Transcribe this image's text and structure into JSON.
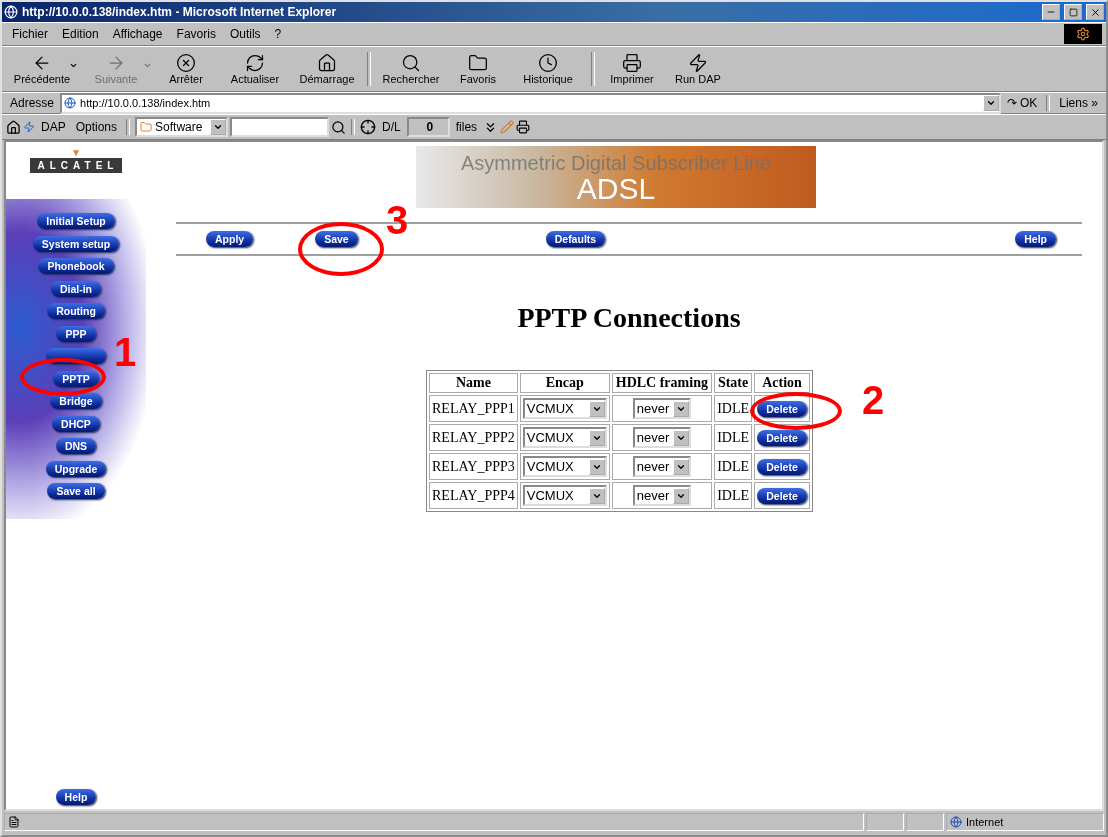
{
  "window": {
    "title": "http://10.0.0.138/index.htm - Microsoft Internet Explorer"
  },
  "menu": [
    "Fichier",
    "Edition",
    "Affichage",
    "Favoris",
    "Outils",
    "?"
  ],
  "toolbar": [
    {
      "label": "Précédente",
      "dropdown": true,
      "disabled": false
    },
    {
      "label": "Suivante",
      "dropdown": true,
      "disabled": true
    },
    {
      "label": "Arrêter",
      "dropdown": false,
      "disabled": false
    },
    {
      "label": "Actualiser",
      "dropdown": false,
      "disabled": false
    },
    {
      "label": "Démarrage",
      "dropdown": false,
      "disabled": false
    },
    {
      "label": "Rechercher",
      "dropdown": false,
      "disabled": false
    },
    {
      "label": "Favoris",
      "dropdown": false,
      "disabled": false
    },
    {
      "label": "Historique",
      "dropdown": false,
      "disabled": false
    },
    {
      "label": "Imprimer",
      "dropdown": false,
      "disabled": false
    },
    {
      "label": "Run DAP",
      "dropdown": false,
      "disabled": false
    }
  ],
  "address": {
    "label": "Adresse",
    "value": "http://10.0.0.138/index.htm",
    "go_glyph": "↷",
    "go": "OK",
    "links": "Liens",
    "links_glyph": "»"
  },
  "dap_bar": {
    "dap": "DAP",
    "options": "Options",
    "category": "Software",
    "dl_label": "D/L",
    "dl_count": "0",
    "files": "files"
  },
  "page": {
    "logo_mark": "▼",
    "logo": "ALCATEL",
    "banner_title": "ADSL",
    "banner_subtitle": "Asymmetric Digital Subscriber Line",
    "sidebar": [
      {
        "label": "Initial Setup",
        "kind": "button"
      },
      {
        "label": "System setup",
        "kind": "button"
      },
      {
        "label": "Phonebook",
        "kind": "button"
      },
      {
        "label": "Dial-in",
        "kind": "button"
      },
      {
        "label": "Routing",
        "kind": "button"
      },
      {
        "label": "PPP",
        "kind": "button"
      },
      {
        "kind": "covered"
      },
      {
        "label": "PPTP",
        "kind": "button"
      },
      {
        "label": "Bridge",
        "kind": "button"
      },
      {
        "label": "DHCP",
        "kind": "button"
      },
      {
        "label": "DNS",
        "kind": "button"
      },
      {
        "label": "Upgrade",
        "kind": "button"
      },
      {
        "label": "Save all",
        "kind": "button"
      }
    ],
    "sidebar_help": "Help",
    "actions": [
      "Apply",
      "Save",
      "Defaults",
      "Help"
    ],
    "heading": "PPTP Connections",
    "table": {
      "columns": [
        "Name",
        "Encap",
        "HDLC framing",
        "State",
        "Action"
      ],
      "rows": [
        {
          "name": "RELAY_PPP1",
          "encap": "VCMUX",
          "hdlc": "never",
          "state": "IDLE",
          "action": "Delete"
        },
        {
          "name": "RELAY_PPP2",
          "encap": "VCMUX",
          "hdlc": "never",
          "state": "IDLE",
          "action": "Delete"
        },
        {
          "name": "RELAY_PPP3",
          "encap": "VCMUX",
          "hdlc": "never",
          "state": "IDLE",
          "action": "Delete"
        },
        {
          "name": "RELAY_PPP4",
          "encap": "VCMUX",
          "hdlc": "never",
          "state": "IDLE",
          "action": "Delete"
        }
      ]
    },
    "annotations": [
      "1",
      "2",
      "3"
    ]
  },
  "status_bar": {
    "zone": "Internet"
  }
}
